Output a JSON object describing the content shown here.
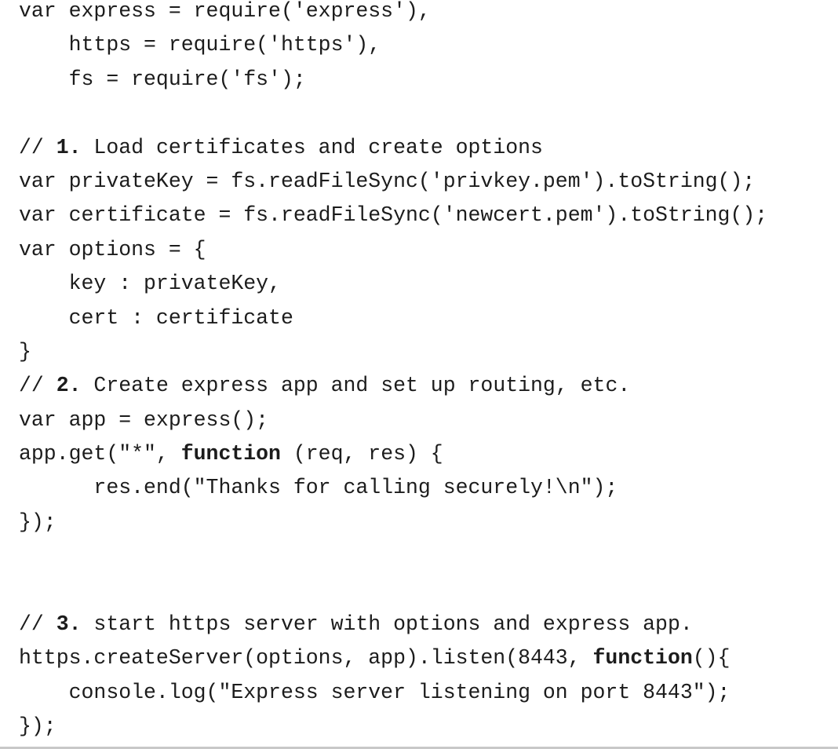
{
  "code": {
    "line_01": "var express = require('express'),",
    "line_02": "    https = require('https'),",
    "line_03": "    fs = require('fs');",
    "line_04": "",
    "line_05a": "// ",
    "line_05b": "1.",
    "line_05c": " Load certificates and create options",
    "line_06": "var privateKey = fs.readFileSync('privkey.pem').toString();",
    "line_07": "var certificate = fs.readFileSync('newcert.pem').toString();",
    "line_08": "var options = {",
    "line_09": "    key : privateKey,",
    "line_10": "    cert : certificate",
    "line_11": "}",
    "line_12a": "// ",
    "line_12b": "2.",
    "line_12c": " Create express app and set up routing, etc.",
    "line_13": "var app = express();",
    "line_14a": "app.get(\"*\", ",
    "line_14b": "function",
    "line_14c": " (req, res) {",
    "line_15": "      res.end(\"Thanks for calling securely!\\n\");",
    "line_16": "});",
    "line_19a": "// ",
    "line_19b": "3.",
    "line_19c": " start https server with options and express app.",
    "line_20a": "https.createServer(options, app).listen(8443, ",
    "line_20b": "function",
    "line_20c": "(){",
    "line_21": "    console.log(\"Express server listening on port 8443\");",
    "line_22": "});"
  }
}
